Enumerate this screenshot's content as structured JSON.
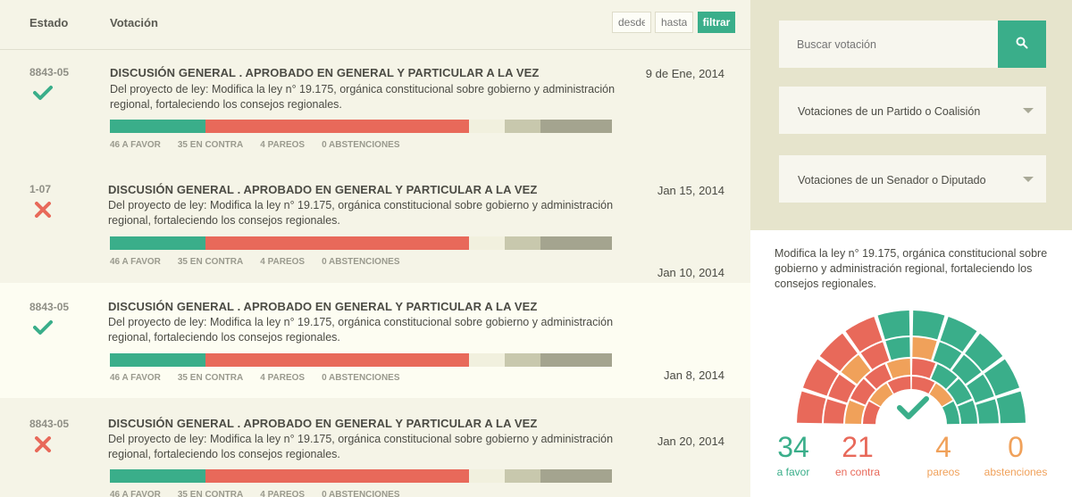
{
  "header": {
    "estado": "Estado",
    "votacion": "Votación",
    "desde_placeholder": "desde",
    "hasta_placeholder": "hasta",
    "filtrar": "filtrar"
  },
  "rows": [
    {
      "code": "8843-05",
      "status": "approved",
      "title": "DISCUSIÓN GENERAL . APROBADO EN GENERAL Y PARTICULAR A LA VEZ",
      "desc": "Del proyecto de ley: Modifica la ley n° 19.175, orgánica constitucional sobre gobierno y administración regional, fortaleciendo los consejos regionales.",
      "date": "9 de Ene, 2014",
      "favor": "46 A FAVOR",
      "contra": "35 EN CONTRA",
      "pareos": "4 PAREOS",
      "abstenciones": "0 ABSTENCIONES"
    },
    {
      "code": "1-07",
      "status": "rejected",
      "title": "DISCUSIÓN GENERAL . APROBADO EN GENERAL Y PARTICULAR A LA VEZ",
      "desc": "Del proyecto de ley: Modifica la ley n° 19.175, orgánica constitucional sobre gobierno y administración regional, fortaleciendo los consejos regionales.",
      "date": "Jan 15, 2014",
      "date2": "Jan 10, 2014",
      "favor": "46 A FAVOR",
      "contra": "35 EN CONTRA",
      "pareos": "4 PAREOS",
      "abstenciones": "0 ABSTENCIONES"
    },
    {
      "code": "8843-05",
      "status": "approved",
      "title": "DISCUSIÓN GENERAL . APROBADO EN GENERAL Y PARTICULAR A LA VEZ",
      "desc": "Del proyecto de ley: Modifica la ley n° 19.175, orgánica constitucional sobre gobierno y administración regional, fortaleciendo los consejos regionales.",
      "date": "Jan 8, 2014",
      "favor": "46 A FAVOR",
      "contra": "35 EN CONTRA",
      "pareos": "4 PAREOS",
      "abstenciones": "0 ABSTENCIONES"
    },
    {
      "code": "8843-05",
      "status": "rejected",
      "title": "DISCUSIÓN GENERAL . APROBADO EN GENERAL Y PARTICULAR A LA VEZ",
      "desc": "Del proyecto de ley: Modifica la ley n° 19.175, orgánica constitucional sobre gobierno y administración regional, fortaleciendo los consejos regionales.",
      "date": "Jan 20, 2014",
      "favor": "46 A FAVOR",
      "contra": "35 EN CONTRA",
      "pareos": "4 PAREOS",
      "abstenciones": "0 ABSTENCIONES"
    }
  ],
  "sidebar": {
    "search_placeholder": "Buscar votación",
    "dropdown_partido": "Votaciones de un Partido o Coalisión",
    "dropdown_senador": "Votaciones de un Senador o Diputado",
    "detail_desc": "Modifica la ley n° 19.175, orgánica constitucional sobre gobierno y administración regional, fortaleciendo los consejos regionales.",
    "stats": {
      "favor_num": "34",
      "favor_label": "a favor",
      "contra_num": "21",
      "contra_label": "en contra",
      "pareos_num": "4",
      "pareos_label": "pareos",
      "abst_num": "0",
      "abst_label": "abstenciones"
    }
  },
  "colors": {
    "favor": "#3aae8a",
    "contra": "#e8695a",
    "pareos": "#f0a15a",
    "sidebar_bg": "#e6e4cc",
    "list_bg": "#f5f4e7"
  }
}
